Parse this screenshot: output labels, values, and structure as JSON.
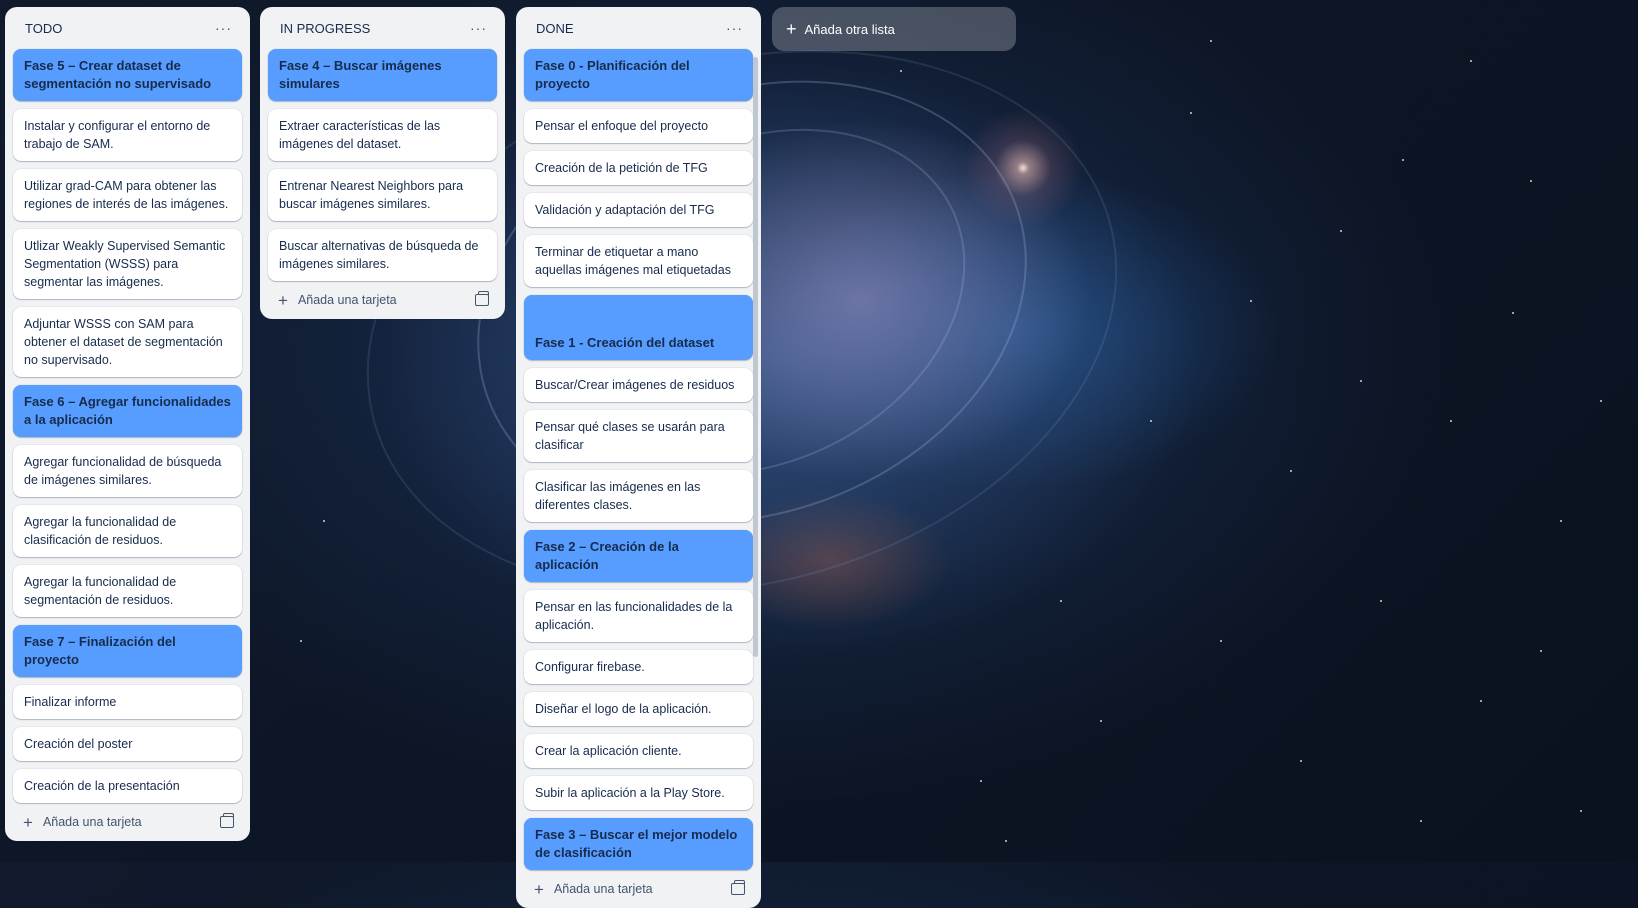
{
  "lists": [
    {
      "title": "TODO",
      "menu": "···",
      "cards": [
        {
          "text": "Fase 5 – Crear dataset de segmentación no supervisado",
          "phase": true
        },
        {
          "text": "Instalar y configurar el entorno de trabajo de SAM."
        },
        {
          "text": "Utilizar grad-CAM para obtener las regiones de interés de las imágenes."
        },
        {
          "text": "Utlizar Weakly Supervised Semantic Segmentation (WSSS) para segmentar las imágenes."
        },
        {
          "text": "Adjuntar WSSS con SAM para obtener el dataset de segmentación no supervisado."
        },
        {
          "text": "Fase 6 – Agregar funcionalidades a la aplicación",
          "phase": true
        },
        {
          "text": "Agregar funcionalidad de búsqueda de imágenes similares."
        },
        {
          "text": "Agregar la funcionalidad de clasificación de residuos."
        },
        {
          "text": "Agregar la funcionalidad de segmentación de residuos."
        },
        {
          "text": "Fase 7 – Finalización del proyecto",
          "phase": true
        },
        {
          "text": "Finalizar informe"
        },
        {
          "text": "Creación del poster"
        },
        {
          "text": "Creación de la presentación"
        }
      ],
      "add_card": "Añada una tarjeta"
    },
    {
      "title": "IN PROGRESS",
      "menu": "···",
      "cards": [
        {
          "text": "Fase 4 – Buscar imágenes simulares",
          "phase": true
        },
        {
          "text": "Extraer características de las imágenes del dataset."
        },
        {
          "text": "Entrenar Nearest Neighbors para buscar imágenes similares."
        },
        {
          "text": "Buscar alternativas de búsqueda de imágenes similares."
        }
      ],
      "add_card": "Añada una tarjeta"
    },
    {
      "title": "DONE",
      "menu": "···",
      "cards": [
        {
          "text": "Fase 0 - Planificación del proyecto",
          "phase": true
        },
        {
          "text": "Pensar el enfoque del proyecto"
        },
        {
          "text": "Creación de la petición de TFG"
        },
        {
          "text": "Validación y adaptación del TFG"
        },
        {
          "text": "Terminar de etiquetar a mano aquellas imágenes mal etiquetadas"
        },
        {
          "text": "Fase 1 - Creación del dataset",
          "phase": true,
          "tall": true
        },
        {
          "text": "Buscar/Crear imágenes de residuos"
        },
        {
          "text": "Pensar qué clases se usarán para clasificar"
        },
        {
          "text": "Clasificar las imágenes en las diferentes clases."
        },
        {
          "text": "Fase 2 – Creación de la aplicación",
          "phase": true
        },
        {
          "text": "Pensar en las funcionalidades de la aplicación."
        },
        {
          "text": "Configurar firebase."
        },
        {
          "text": "Diseñar el logo de la aplicación."
        },
        {
          "text": "Crear la aplicación cliente."
        },
        {
          "text": "Subir la aplicación a la Play Store."
        },
        {
          "text": "Fase 3 – Buscar el mejor modelo de clasificación",
          "phase": true
        }
      ],
      "add_card": "Añada una tarjeta"
    }
  ],
  "add_list": "Añada otra lista",
  "colors": {
    "phase_card": "#579dff",
    "list_bg": "#f1f2f4",
    "card_bg": "#ffffff"
  },
  "icons": {
    "menu": "ellipsis-icon",
    "add": "plus-icon",
    "template": "card-template-icon"
  }
}
